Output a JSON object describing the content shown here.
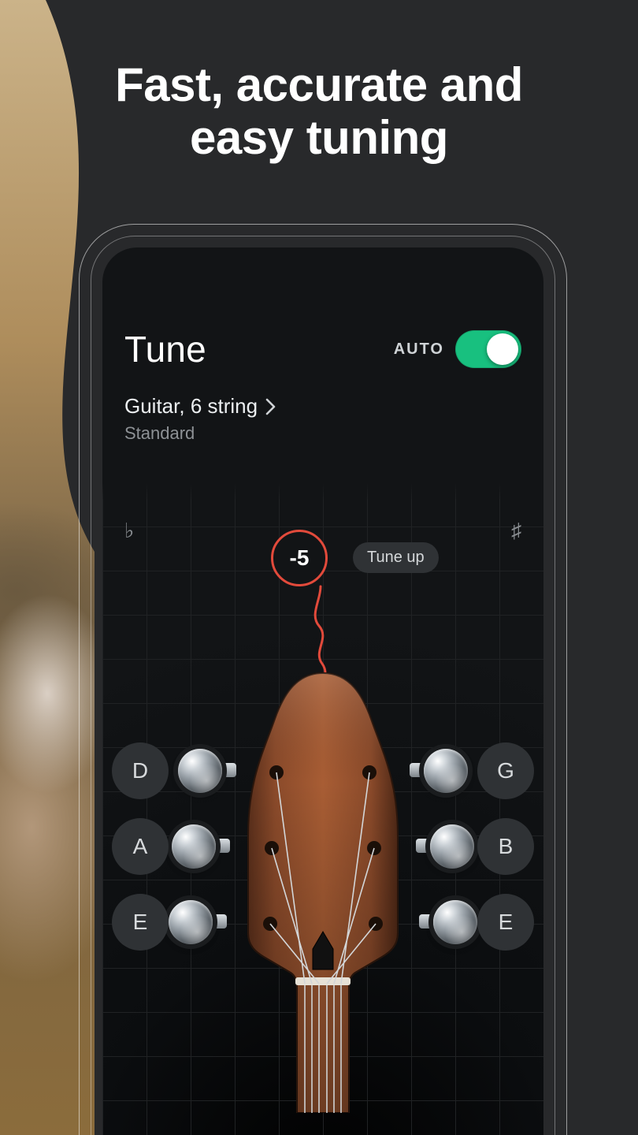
{
  "promo": {
    "headline_line1": "Fast, accurate and",
    "headline_line2": "easy tuning"
  },
  "header": {
    "title": "Tune",
    "auto_label": "AUTO",
    "auto_on": true
  },
  "instrument": {
    "name": "Guitar, 6 string",
    "tuning_name": "Standard"
  },
  "meter": {
    "flat_symbol": "♭",
    "sharp_symbol": "♯",
    "cents_value": "-5",
    "hint": "Tune up",
    "indicator_color": "#e24a3b"
  },
  "strings": {
    "left": [
      "D",
      "A",
      "E"
    ],
    "right": [
      "G",
      "B",
      "E"
    ]
  },
  "colors": {
    "bg": "#28292b",
    "screen": "#121416",
    "toggle_on": "#18c07f"
  }
}
